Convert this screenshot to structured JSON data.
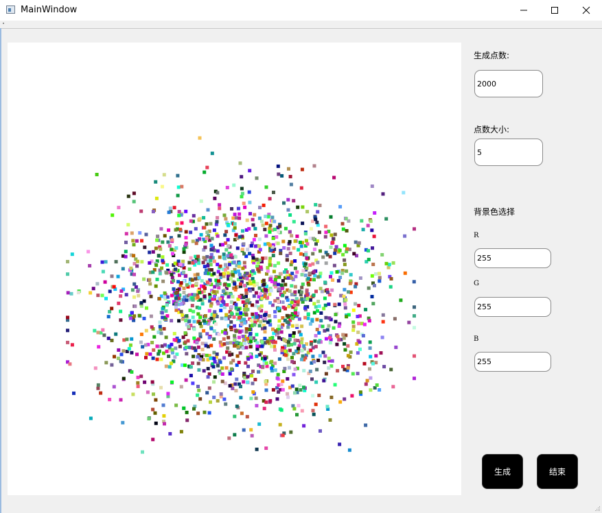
{
  "window": {
    "title": "MainWindow",
    "icons": {
      "app": "window-app-icon",
      "minimize": "minimize-icon",
      "maximize": "maximize-icon",
      "close": "close-icon"
    }
  },
  "canvas": {
    "background_color": "#ffffff",
    "point_count": 2000,
    "point_size": 5
  },
  "controls": {
    "point_count_label": "生成点数:",
    "point_count_value": "2000",
    "point_size_label": "点数大小:",
    "point_size_value": "5",
    "bg_color_label": "背景色选择",
    "r_label": "R",
    "r_value": "255",
    "g_label": "G",
    "g_value": "255",
    "b_label": "B",
    "b_value": "255"
  },
  "buttons": {
    "generate_label": "生成",
    "end_label": "结束"
  }
}
